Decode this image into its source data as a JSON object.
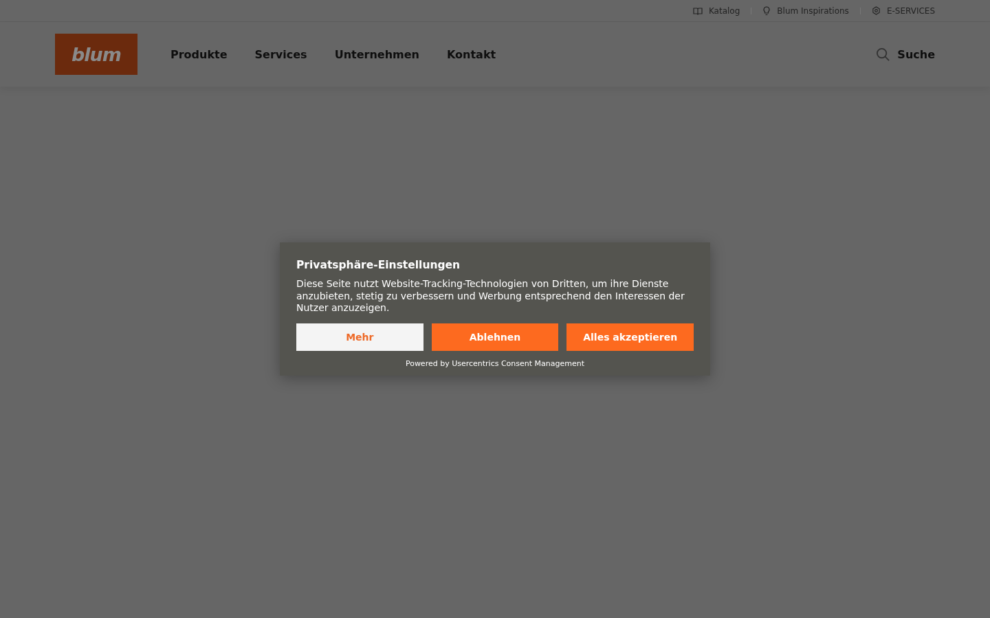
{
  "utility_nav": [
    {
      "kind": "book",
      "label": "Katalog"
    },
    {
      "kind": "bulb",
      "label": "Blum Inspirations"
    },
    {
      "kind": "gear",
      "label": "E-SERVICES"
    }
  ],
  "header": {
    "logo": "blum",
    "nav": [
      "Produkte",
      "Services",
      "Unternehmen",
      "Kontakt"
    ],
    "search": "Suche"
  },
  "consent": {
    "title": "Privatsphäre-Einstellungen",
    "text": "Diese Seite nutzt Website-Tracking-Technologien von Dritten, um ihre Dienste anzubieten, stetig zu verbessern und Werbung entsprechend den Interessen der Nutzer anzuzeigen.",
    "buttons": [
      {
        "kind": "secondary",
        "label": "Mehr"
      },
      {
        "kind": "primary",
        "label": "Ablehnen"
      },
      {
        "kind": "primary",
        "label": "Alles akzeptieren"
      }
    ],
    "footer": "Powered by Usercentrics Consent Management"
  }
}
